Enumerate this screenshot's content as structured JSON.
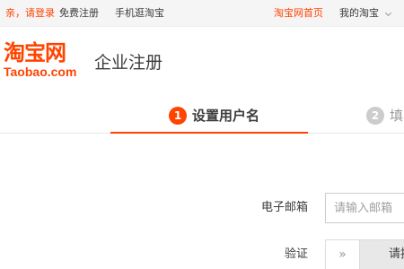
{
  "topbar": {
    "login": "亲，请登录",
    "register": "免费注册",
    "mobile": "手机逛淘宝",
    "home": "淘宝网首页",
    "my_taobao": "我的淘宝"
  },
  "header": {
    "logo_cn": "淘宝网",
    "logo_en": "Taobao.com",
    "title": "企业注册"
  },
  "steps": [
    {
      "number": "1",
      "label": "设置用户名",
      "state": "active"
    },
    {
      "number": "2",
      "label": "填写",
      "state": "inactive"
    }
  ],
  "form": {
    "email_label": "电子邮箱",
    "email_placeholder": "请输入邮箱",
    "verify_label": "验证",
    "slider_handle": "»",
    "slider_text": "请按住滑块，拖动到最右边"
  },
  "colors": {
    "brand": "#ff4400",
    "inactive_step": "#cccccc"
  }
}
